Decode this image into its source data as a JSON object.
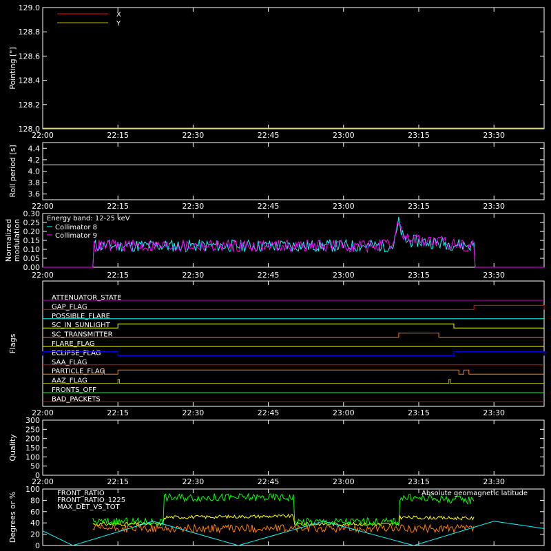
{
  "time_ticks": [
    "22:00",
    "22:15",
    "22:30",
    "22:45",
    "23:00",
    "23:15",
    "23:30"
  ],
  "colors": {
    "background": "#000000",
    "axis": "#ffffff",
    "red": "#ff0000",
    "olive": "#b8b800",
    "cyan": "#00ffff",
    "magenta": "#ff00ff",
    "green": "#00ff00",
    "orange": "#ff8000",
    "yellow": "#ffff00",
    "blue": "#0000ff",
    "lightblue": "#4080ff",
    "purple": "#c000c0"
  },
  "chart_data": [
    {
      "type": "line",
      "ylabel": "Pointing [\"]",
      "ylim": [
        128.0,
        129.0
      ],
      "yticks": [
        "128.0",
        "128.2",
        "128.4",
        "128.6",
        "128.8",
        "129.0"
      ],
      "legend": [
        "X",
        "Y"
      ],
      "series": [
        {
          "name": "X",
          "color": "#ff0000",
          "values": []
        },
        {
          "name": "Y",
          "color": "#b8b800",
          "values": []
        }
      ]
    },
    {
      "type": "line",
      "ylabel": "Roll period [s]",
      "ylim": [
        3.5,
        4.5
      ],
      "yticks": [
        "3.6",
        "3.8",
        "4.0",
        "4.2",
        "4.4"
      ],
      "series": [
        {
          "color": "#ffffff",
          "x": [
            "22:00",
            "22:15",
            "22:30",
            "22:45",
            "23:00",
            "23:15",
            "23:30",
            "23:40"
          ],
          "values": [
            4.11,
            4.11,
            4.11,
            4.11,
            4.11,
            4.11,
            4.11,
            4.11
          ]
        }
      ]
    },
    {
      "type": "line",
      "ylabel": "Normalized modulation",
      "ylim": [
        0.0,
        0.3
      ],
      "yticks": [
        "0.00",
        "0.05",
        "0.10",
        "0.15",
        "0.20",
        "0.25",
        "0.30"
      ],
      "annotation": "Energy band: 12-25 keV",
      "series": [
        {
          "name": "Collimator 8",
          "color": "#00ffff",
          "x": [
            "22:00",
            "22:10",
            "22:10",
            "23:10",
            "23:11",
            "23:12",
            "23:26",
            "23:26",
            "23:40"
          ],
          "values": [
            0.0,
            0.0,
            0.12,
            0.12,
            0.25,
            0.15,
            0.12,
            0.0,
            0.0
          ]
        },
        {
          "name": "Collimator 9",
          "color": "#ff00ff",
          "x": [
            "22:00",
            "22:10",
            "22:10",
            "23:10",
            "23:11",
            "23:12",
            "23:26",
            "23:26",
            "23:40"
          ],
          "values": [
            0.0,
            0.0,
            0.12,
            0.12,
            0.27,
            0.16,
            0.12,
            0.0,
            0.0
          ]
        }
      ]
    },
    {
      "type": "line",
      "ylabel": "Flags",
      "flags": [
        {
          "name": "ATTENUATOR_STATE",
          "color": "#c000c0",
          "steps": []
        },
        {
          "name": "GAP_FLAG",
          "color": "#ff0000",
          "steps": [
            [
              "23:26",
              "23:40"
            ]
          ]
        },
        {
          "name": "POSSIBLE_FLARE",
          "color": "#00ffff",
          "steps": []
        },
        {
          "name": "SC_IN_SUNLIGHT",
          "color": "#ffff00",
          "steps": [
            [
              "22:15",
              "23:22"
            ]
          ]
        },
        {
          "name": "SC_TRANSMITTER",
          "color": "#ff8000",
          "steps": [
            [
              "23:11",
              "23:19"
            ]
          ]
        },
        {
          "name": "FLARE_FLAG",
          "color": "#ffff00",
          "steps": []
        },
        {
          "name": "ECLIPSE_FLAG",
          "color": "#0000ff",
          "steps": [
            [
              "22:00",
              "22:15"
            ],
            [
              "23:22",
              "23:40"
            ]
          ]
        },
        {
          "name": "SAA_FLAG",
          "color": "#ff0000",
          "steps": []
        },
        {
          "name": "PARTICLE_FLAG",
          "color": "#ff8000",
          "steps": [
            [
              "22:12",
              "22:12"
            ],
            [
              "22:15",
              "23:23"
            ],
            [
              "23:24",
              "23:25"
            ]
          ]
        },
        {
          "name": "AAZ_FLAG",
          "color": "#b8b800",
          "steps": [
            [
              "22:15",
              "22:15"
            ],
            [
              "23:21",
              "23:21"
            ]
          ]
        },
        {
          "name": "FRONTS_OFF",
          "color": "#00ff00",
          "steps": []
        },
        {
          "name": "BAD_PACKETS",
          "color": "#ff0000",
          "steps": []
        }
      ]
    },
    {
      "type": "line",
      "ylabel": "Quality",
      "ylim": [
        0,
        300
      ],
      "yticks": [
        "0",
        "50",
        "100",
        "150",
        "200",
        "250",
        "300"
      ],
      "series": []
    },
    {
      "type": "line",
      "ylabel": "Degrees or %",
      "ylim": [
        0,
        100
      ],
      "yticks": [
        "0",
        "20",
        "40",
        "60",
        "80",
        "100"
      ],
      "series": [
        {
          "name": "FRONT_RATIO",
          "color": "#ffff00",
          "x": [
            "22:10",
            "22:24",
            "22:24",
            "22:50",
            "22:50",
            "23:11",
            "23:11",
            "23:26"
          ],
          "values": [
            38,
            38,
            50,
            52,
            38,
            38,
            50,
            48
          ]
        },
        {
          "name": "FRONT_RATIO_1225",
          "color": "#00ff00",
          "x": [
            "22:10",
            "22:24",
            "22:24",
            "22:50",
            "22:50",
            "23:11",
            "23:11",
            "23:26"
          ],
          "values": [
            42,
            42,
            85,
            85,
            42,
            42,
            85,
            80
          ]
        },
        {
          "name": "MAX_DET_VS_TOT",
          "color": "#ff8000",
          "x": [
            "22:10",
            "22:24",
            "22:24",
            "22:50",
            "22:50",
            "23:11",
            "23:11",
            "23:26"
          ],
          "values": [
            30,
            30,
            30,
            30,
            30,
            30,
            30,
            30
          ]
        },
        {
          "name": "Absolute geomagnetic latitude",
          "color": "#00ffff",
          "x": [
            "22:00",
            "22:06",
            "22:22",
            "22:39",
            "22:56",
            "23:14",
            "23:30",
            "23:40"
          ],
          "values": [
            26,
            0,
            43,
            0,
            43,
            0,
            43,
            30
          ]
        }
      ]
    }
  ]
}
